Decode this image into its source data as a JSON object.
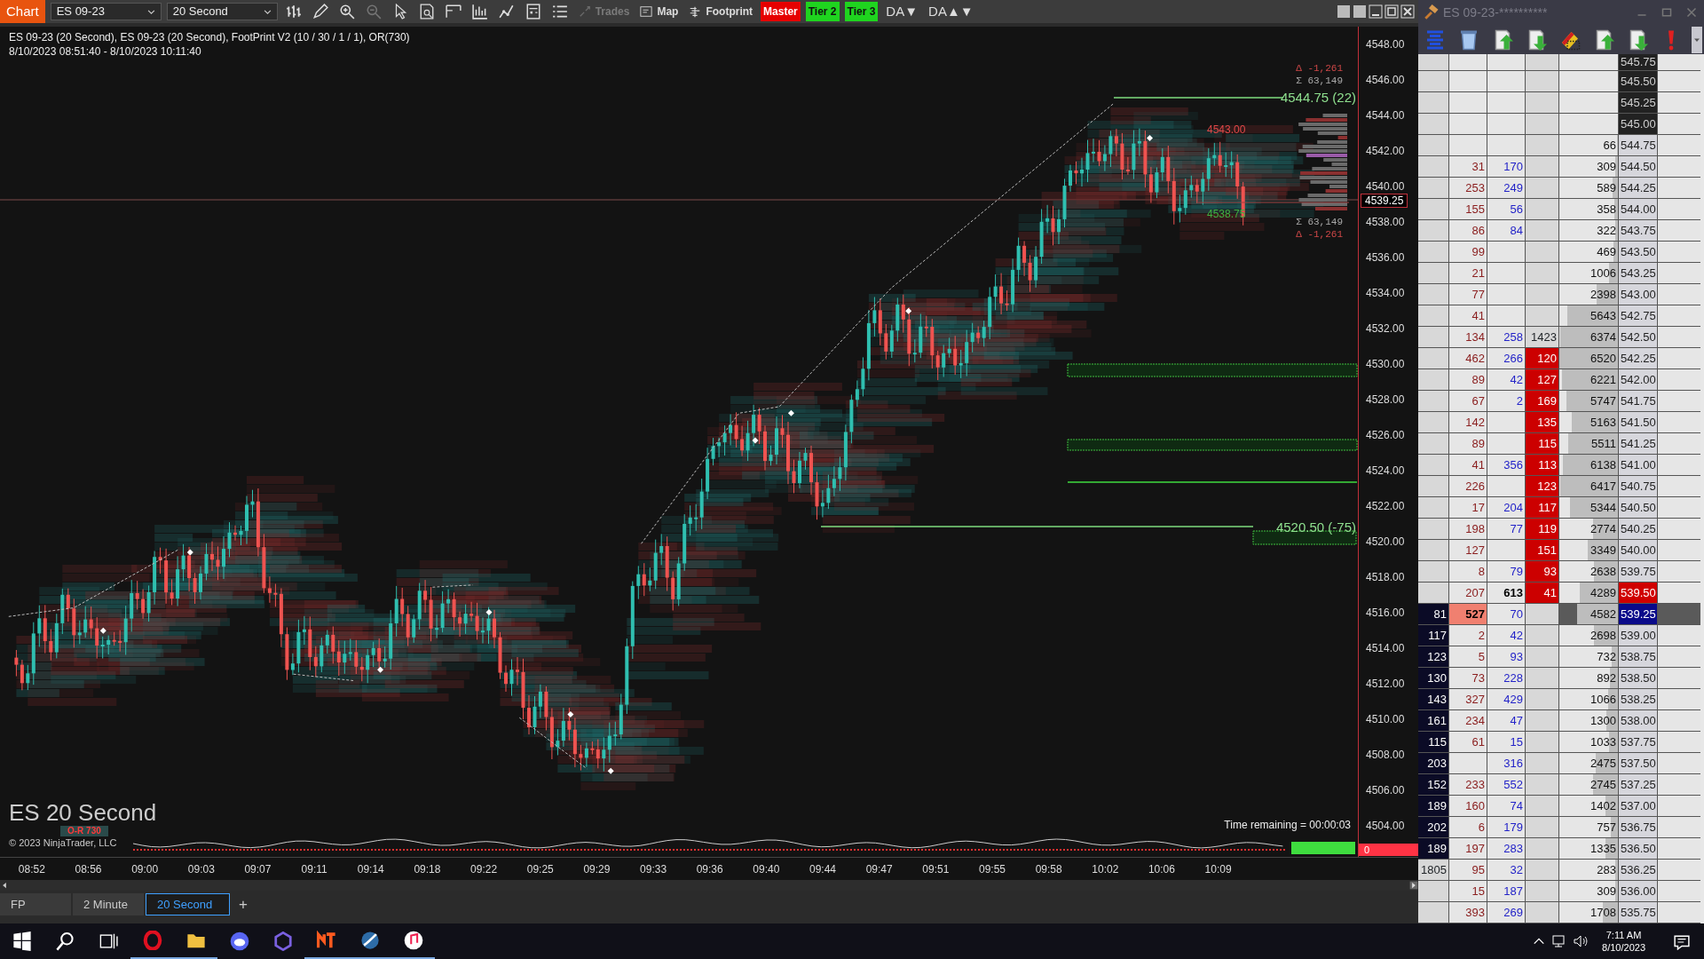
{
  "toolbar": {
    "title": "Chart",
    "instrument": "ES 09-23",
    "interval": "20 Second",
    "icon_buttons": [
      {
        "disabled": false
      },
      {
        "disabled": false
      },
      {
        "disabled": false
      },
      {
        "disabled": true
      },
      {
        "disabled": false
      },
      {
        "disabled": false
      },
      {
        "disabled": false
      },
      {
        "disabled": false
      },
      {
        "disabled": false
      },
      {
        "disabled": false
      },
      {
        "disabled": false
      }
    ],
    "buttons": [
      {
        "label": "Trades",
        "kind": "icon",
        "disabled": true
      },
      {
        "label": "Map",
        "kind": "icon",
        "disabled": false
      },
      {
        "label": "Footprint",
        "kind": "icon",
        "disabled": false
      },
      {
        "label": "Master",
        "kind": "red",
        "disabled": false
      },
      {
        "label": "Tier 2",
        "kind": "green",
        "disabled": false
      },
      {
        "label": "Tier 3",
        "kind": "green",
        "disabled": false
      },
      {
        "label": "DA▼",
        "kind": "text",
        "disabled": false
      },
      {
        "label": "DA▲▼",
        "kind": "text",
        "disabled": false
      }
    ]
  },
  "chart": {
    "header": [
      "ES 09-23 (20 Second), ES 09-23 (20 Second), FootPrint V2 (10 / 30 / 1 / 1), OR(730)",
      "8/10/2023 08:51:40 - 8/10/2023 10:11:40"
    ],
    "labels": [
      {
        "text": "Δ -1,261",
        "kind": "delta"
      },
      {
        "text": "Σ 63,149",
        "kind": "sum"
      },
      {
        "text": "4544.75 (22)",
        "kind": "high"
      },
      {
        "text": "4543.00",
        "kind": "red"
      },
      {
        "text": "4538.75",
        "kind": "green"
      },
      {
        "text": "Σ 63,149",
        "kind": "sum"
      },
      {
        "text": "Δ -1,261",
        "kind": "delta"
      },
      {
        "text": "4520.50 (-75)",
        "kind": "high"
      }
    ],
    "price_axis": [
      "4548.00",
      "4546.00",
      "4544.00",
      "4542.00",
      "4540.00",
      "4538.00",
      "4536.00",
      "4534.00",
      "4532.00",
      "4530.00",
      "4528.00",
      "4526.00",
      "4524.00",
      "4522.00",
      "4520.00",
      "4518.00",
      "4516.00",
      "4514.00",
      "4512.00",
      "4510.00",
      "4508.00",
      "4506.00",
      "4504.00"
    ],
    "last_price": "4539.25",
    "instrument_label": "ES 20 Second",
    "or_label": "O-R 730",
    "copyright": "© 2023 NinjaTrader, LLC",
    "time_remaining": "Time remaining = 00:00:03",
    "indicator_value": "0",
    "time_axis": [
      "08:52",
      "08:56",
      "09:00",
      "09:03",
      "09:07",
      "09:11",
      "09:14",
      "09:18",
      "09:22",
      "09:25",
      "09:29",
      "09:33",
      "09:36",
      "09:40",
      "09:44",
      "09:47",
      "09:51",
      "09:55",
      "09:58",
      "10:02",
      "10:06",
      "10:09"
    ]
  },
  "tabs": [
    {
      "label": "FP",
      "selected": false
    },
    {
      "label": "2 Minute",
      "selected": false
    },
    {
      "label": "20 Second",
      "selected": true
    }
  ],
  "add_tab": "+",
  "dom": {
    "title": "ES 09-23-**********",
    "rows": [
      {
        "price": "545.75",
        "kind": "offer",
        "c1_dark": false,
        "c2_hot": false,
        "c4_red": false
      },
      {
        "price": "545.50",
        "kind": "offer",
        "c1_dark": false,
        "c2_hot": false,
        "c4_red": false
      },
      {
        "price": "545.25",
        "kind": "offer",
        "c1_dark": false,
        "c2_hot": false,
        "c4_red": false
      },
      {
        "price": "545.00",
        "kind": "offer",
        "c1_dark": false,
        "c2_hot": false,
        "c4_red": false
      },
      {
        "volume": "66",
        "price": "544.75",
        "kind": "plain",
        "c1_dark": false,
        "c2_hot": false,
        "c4_red": false
      },
      {
        "c2": "31",
        "c3": "170",
        "volume": "309",
        "price": "544.50",
        "kind": "plain",
        "c1_dark": false,
        "c2_hot": false,
        "c3_bold": false,
        "c4_red": false
      },
      {
        "c2": "253",
        "c3": "249",
        "volume": "589",
        "price": "544.25",
        "kind": "plain",
        "c1_dark": false,
        "c2_hot": false,
        "c3_bold": false,
        "c4_red": false
      },
      {
        "c2": "155",
        "c3": "56",
        "volume": "358",
        "price": "544.00",
        "kind": "plain",
        "c1_dark": false,
        "c2_hot": false,
        "c3_bold": false,
        "c4_red": false
      },
      {
        "c2": "86",
        "c3": "84",
        "volume": "322",
        "price": "543.75",
        "kind": "plain",
        "c1_dark": false,
        "c2_hot": false,
        "c3_bold": false,
        "c4_red": false
      },
      {
        "c2": "99",
        "volume": "469",
        "price": "543.50",
        "kind": "plain",
        "c1_dark": false,
        "c2_hot": false,
        "c4_red": false
      },
      {
        "c2": "21",
        "volume": "1006",
        "price": "543.25",
        "kind": "plain",
        "c1_dark": false,
        "c2_hot": false,
        "c4_red": false
      },
      {
        "c2": "77",
        "volume": "2398",
        "price": "543.00",
        "kind": "plain",
        "c1_dark": false,
        "c2_hot": false,
        "c4_red": false
      },
      {
        "c2": "41",
        "volume": "5643",
        "price": "542.75",
        "kind": "plain",
        "c1_dark": false,
        "c2_hot": false,
        "c4_red": false
      },
      {
        "c2": "134",
        "c3": "258",
        "c4": "1423",
        "volume": "6374",
        "price": "542.50",
        "kind": "plain",
        "c1_dark": false,
        "c2_hot": false,
        "c3_bold": false,
        "c4_red": false
      },
      {
        "c2": "462",
        "c3": "266",
        "c4": "120",
        "volume": "6520",
        "price": "542.25",
        "kind": "plain",
        "c1_dark": false,
        "c2_hot": false,
        "c3_bold": false,
        "c4_red": true
      },
      {
        "c2": "89",
        "c3": "42",
        "c4": "127",
        "volume": "6221",
        "price": "542.00",
        "kind": "plain",
        "c1_dark": false,
        "c2_hot": false,
        "c3_bold": false,
        "c4_red": true
      },
      {
        "c2": "67",
        "c3": "2",
        "c4": "169",
        "volume": "5747",
        "price": "541.75",
        "kind": "plain",
        "c1_dark": false,
        "c2_hot": false,
        "c3_bold": false,
        "c4_red": true
      },
      {
        "c2": "142",
        "c4": "135",
        "volume": "5163",
        "price": "541.50",
        "kind": "plain",
        "c1_dark": false,
        "c2_hot": false,
        "c4_red": true
      },
      {
        "c2": "89",
        "c4": "115",
        "volume": "5511",
        "price": "541.25",
        "kind": "plain",
        "c1_dark": false,
        "c2_hot": false,
        "c4_red": true
      },
      {
        "c2": "41",
        "c3": "356",
        "c4": "113",
        "volume": "6138",
        "price": "541.00",
        "kind": "plain",
        "c1_dark": false,
        "c2_hot": false,
        "c3_bold": false,
        "c4_red": true
      },
      {
        "c2": "226",
        "c4": "123",
        "volume": "6417",
        "price": "540.75",
        "kind": "plain",
        "c1_dark": false,
        "c2_hot": false,
        "c4_red": true
      },
      {
        "c2": "17",
        "c3": "204",
        "c4": "117",
        "volume": "5344",
        "price": "540.50",
        "kind": "plain",
        "c1_dark": false,
        "c2_hot": false,
        "c3_bold": false,
        "c4_red": true
      },
      {
        "c2": "198",
        "c3": "77",
        "c4": "119",
        "volume": "2774",
        "price": "540.25",
        "kind": "plain",
        "c1_dark": false,
        "c2_hot": false,
        "c3_bold": false,
        "c4_red": true
      },
      {
        "c2": "127",
        "c4": "151",
        "volume": "3349",
        "price": "540.00",
        "kind": "plain",
        "c1_dark": false,
        "c2_hot": false,
        "c4_red": true
      },
      {
        "c2": "8",
        "c3": "79",
        "c4": "93",
        "volume": "2638",
        "price": "539.75",
        "kind": "plain",
        "c1_dark": false,
        "c2_hot": false,
        "c3_bold": false,
        "c4_red": true
      },
      {
        "c2": "207",
        "c3": "613",
        "c4": "41",
        "volume": "4289",
        "price": "539.50",
        "kind": "ask",
        "c1_dark": false,
        "c2_hot": false,
        "c3_bold": true,
        "c4_red": true
      },
      {
        "c1": "81",
        "c2": "527",
        "c3": "70",
        "volume": "4582",
        "price": "539.25",
        "kind": "last",
        "c1_dark": true,
        "c2_hot": true,
        "c3_bold": false,
        "c4_red": false
      },
      {
        "c1": "117",
        "c2": "2",
        "c3": "42",
        "volume": "2698",
        "price": "539.00",
        "kind": "plain",
        "c1_dark": true,
        "c2_hot": false,
        "c3_bold": false,
        "c4_red": false
      },
      {
        "c1": "123",
        "c2": "5",
        "c3": "93",
        "volume": "732",
        "price": "538.75",
        "kind": "plain",
        "c1_dark": true,
        "c2_hot": false,
        "c3_bold": false,
        "c4_red": false
      },
      {
        "c1": "130",
        "c2": "73",
        "c3": "228",
        "volume": "892",
        "price": "538.50",
        "kind": "plain",
        "c1_dark": true,
        "c2_hot": false,
        "c3_bold": false,
        "c4_red": false
      },
      {
        "c1": "143",
        "c2": "327",
        "c3": "429",
        "volume": "1066",
        "price": "538.25",
        "kind": "plain",
        "c1_dark": true,
        "c2_hot": false,
        "c3_bold": false,
        "c4_red": false
      },
      {
        "c1": "161",
        "c2": "234",
        "c3": "47",
        "volume": "1300",
        "price": "538.00",
        "kind": "plain",
        "c1_dark": true,
        "c2_hot": false,
        "c3_bold": false,
        "c4_red": false
      },
      {
        "c1": "115",
        "c2": "61",
        "c3": "15",
        "volume": "1033",
        "price": "537.75",
        "kind": "plain",
        "c1_dark": true,
        "c2_hot": false,
        "c3_bold": false,
        "c4_red": false
      },
      {
        "c1": "203",
        "c3": "316",
        "volume": "2475",
        "price": "537.50",
        "kind": "plain",
        "c1_dark": true,
        "c2_hot": false,
        "c3_bold": false,
        "c4_red": false
      },
      {
        "c1": "152",
        "c2": "233",
        "c3": "552",
        "volume": "2745",
        "price": "537.25",
        "kind": "plain",
        "c1_dark": true,
        "c2_hot": false,
        "c3_bold": false,
        "c4_red": false
      },
      {
        "c1": "189",
        "c2": "160",
        "c3": "74",
        "volume": "1402",
        "price": "537.00",
        "kind": "plain",
        "c1_dark": true,
        "c2_hot": false,
        "c3_bold": false,
        "c4_red": false
      },
      {
        "c1": "202",
        "c2": "6",
        "c3": "179",
        "volume": "757",
        "price": "536.75",
        "kind": "plain",
        "c1_dark": true,
        "c2_hot": false,
        "c3_bold": false,
        "c4_red": false
      },
      {
        "c1": "189",
        "c2": "197",
        "c3": "283",
        "volume": "1335",
        "price": "536.50",
        "kind": "plain",
        "c1_dark": true,
        "c2_hot": false,
        "c3_bold": false,
        "c4_red": false
      },
      {
        "c1": "1805",
        "c2": "95",
        "c3": "32",
        "volume": "283",
        "price": "536.25",
        "kind": "plain",
        "c1_dark": false,
        "c2_hot": false,
        "c3_bold": false,
        "c4_red": false
      },
      {
        "c2": "15",
        "c3": "187",
        "volume": "309",
        "price": "536.00",
        "kind": "plain",
        "c1_dark": false,
        "c2_hot": false,
        "c3_bold": false,
        "c4_red": false
      },
      {
        "c2": "393",
        "c3": "269",
        "volume": "1708",
        "price": "535.75",
        "kind": "plain",
        "c1_dark": false,
        "c2_hot": false,
        "c3_bold": false,
        "c4_red": false
      }
    ]
  },
  "taskbar": {
    "time": "7:11 AM",
    "date": "8/10/2023"
  }
}
